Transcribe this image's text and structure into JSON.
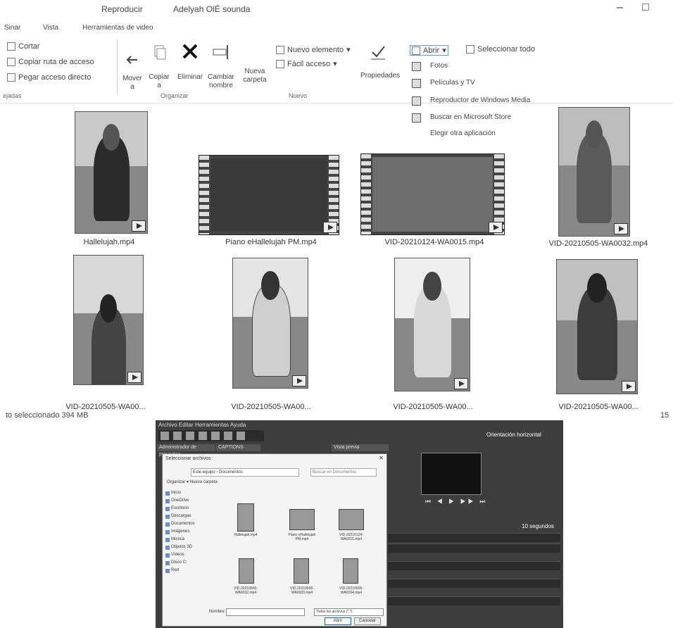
{
  "window": {
    "context_tab": "Reproducir",
    "title": "Adelyah OlÉ sounda",
    "minimize_glyph": "–",
    "restore_glyph": "□"
  },
  "ribbon_tabs": [
    "Sinar",
    "Vista",
    "Herramientas de video"
  ],
  "ribbon": {
    "clipboard": {
      "cut": "Cortar",
      "copy_path": "Copiar ruta de acceso",
      "paste_shortcut": "Pegar acceso directo"
    },
    "organize": {
      "move": "Mover\na",
      "copy": "Copiar\na",
      "delete": "Eliminar",
      "rename": "Cambiar\nnombre",
      "new_folder": "Nueva\ncarpeta"
    },
    "new": {
      "new_item": "Nuevo elemento",
      "easy_access": "Fácil acceso"
    },
    "open": {
      "properties": "Propiedades",
      "open": "Abrir",
      "select_all": "Seleccionar todo"
    },
    "group_labels": [
      "ejadas",
      "Organizar",
      "Nuevo"
    ]
  },
  "open_with_menu": {
    "items": [
      {
        "label": "Fotos",
        "icon": "photos-icon"
      },
      {
        "label": "Películas y TV",
        "icon": "movies-tv-icon"
      },
      {
        "label": "Reproductor de Windows Media",
        "icon": "media-player-icon"
      },
      {
        "label": "Buscar en Microsoft Store",
        "icon": "store-icon"
      },
      {
        "label": "Elegir otra aplicación",
        "icon": ""
      }
    ]
  },
  "files": [
    {
      "name": "Hallelujah.mp4"
    },
    {
      "name": "Piano eHallelujah PM.mp4"
    },
    {
      "name": "VID-20210124-WA0015.mp4"
    },
    {
      "name": "VID-20210505-WA0032.mp4"
    },
    {
      "name": "VID-20210505-WA00..."
    },
    {
      "name": "VID-20210505-WA00..."
    },
    {
      "name": "VID-20210505-WA00..."
    },
    {
      "name": "VID-20210505-WA00..."
    }
  ],
  "status_bar": {
    "selected_text": "to seleccionado  394 MB"
  },
  "editor": {
    "menu_text": "Archivo  Editar  Herramientas  Ayuda",
    "panel_left": "Administrador de proyectos",
    "panel_mid": "CAPTIONS",
    "panel_right": "Vista previa",
    "orientation": "Orientación horizontal",
    "duration": "10 segundos",
    "controls": "⏮ ◀ ▶ ▶▶ ⏭"
  },
  "dialog": {
    "title": "Seleccionar archivos",
    "path": "Este equipo › Documentos",
    "search_placeholder": "Buscar en Documentos",
    "organize": "Organizar ▾   Nueva carpeta",
    "nav": [
      "Inicio",
      "OneDrive",
      "Escritorio",
      "Descargas",
      "Documentos",
      "Imágenes",
      "Música",
      "Objetos 3D",
      "Vídeos",
      "Disco C:",
      "Red"
    ],
    "files": [
      "Hallelujah.mp4",
      "Piano eHallelujah PM.mp4",
      "VID-20210124-WA0015.mp4",
      "VID-20210505-WA0032.mp4",
      "VID-20210505-WA0033.mp4",
      "VID-20210505-WA0034.mp4"
    ],
    "filename_label": "Nombre:",
    "filetype": "Todos los archivos (*.*)",
    "open": "Abrir",
    "cancel": "Cancelar"
  },
  "corner_number": "15"
}
